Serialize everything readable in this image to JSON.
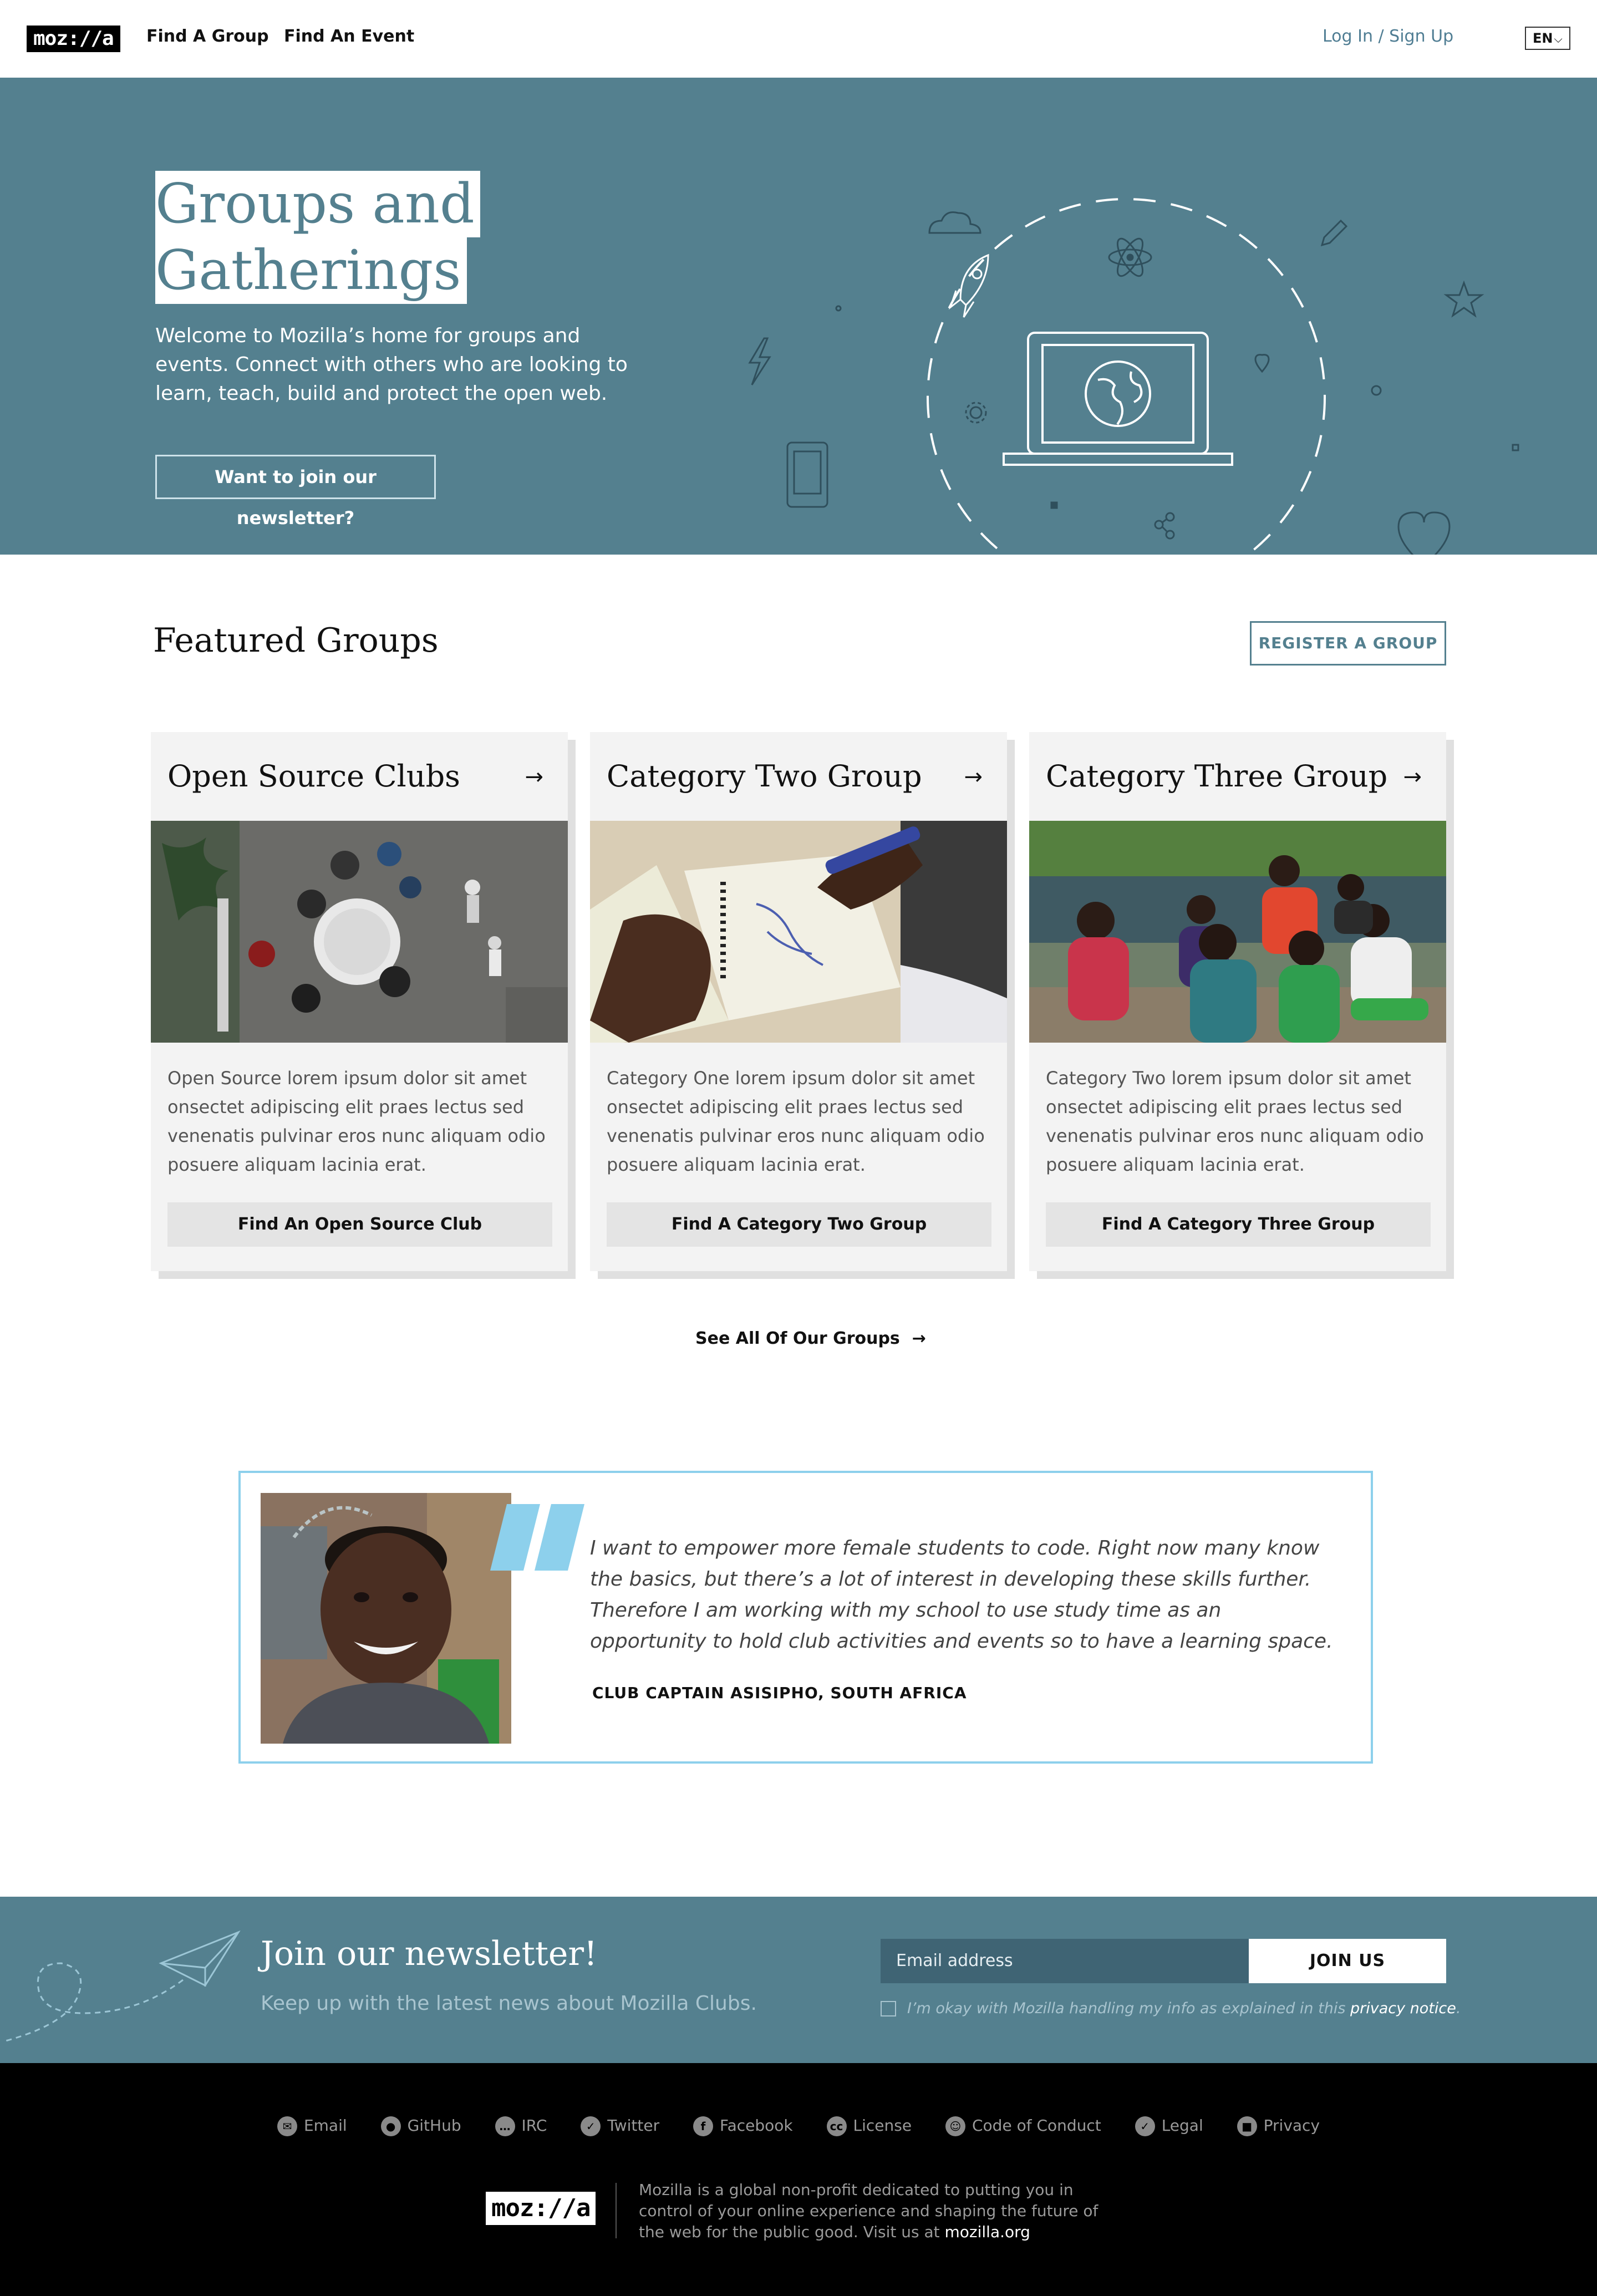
{
  "nav": {
    "logo": "moz://a",
    "links": [
      "Find A Group",
      "Find An Event"
    ],
    "login": "Log In / Sign Up",
    "language": "EN"
  },
  "hero": {
    "title_line1": "Groups and",
    "title_line2": "Gatherings",
    "text": "Welcome to Mozilla’s home for groups and events. Connect with others who are looking to learn, teach, build and protect the open web.",
    "button": "Want to join our newsletter?"
  },
  "featured": {
    "title": "Featured Groups",
    "register_button": "REGISTER A GROUP",
    "cards": [
      {
        "title": "Open Source Clubs",
        "text": "Open Source lorem ipsum dolor sit amet onsectet adipiscing elit praes lectus sed venenatis pulvinar eros nunc aliquam odio posuere aliquam lacinia erat.",
        "button": "Find An Open Source Club"
      },
      {
        "title": "Category Two Group",
        "text": "Category One lorem ipsum dolor sit amet onsectet adipiscing elit praes lectus sed venenatis pulvinar eros nunc aliquam odio posuere aliquam lacinia erat.",
        "button": "Find A Category Two Group"
      },
      {
        "title": "Category Three Group",
        "text": "Category Two lorem ipsum dolor sit amet onsectet adipiscing elit praes lectus sed venenatis pulvinar eros nunc aliquam odio posuere aliquam lacinia erat.",
        "button": "Find A Category Three Group"
      }
    ],
    "see_all": "See All Of Our Groups"
  },
  "testimonial": {
    "quote": "I want to empower more female students to code. Right now many know the basics, but there’s a lot of interest in developing these skills further. Therefore I am working with my school to use study time as an opportunity to hold club activities and events so to have a learning space.",
    "author": "CLUB CAPTAIN ASISIPHO, SOUTH AFRICA"
  },
  "newsletter": {
    "title": "Join our newsletter!",
    "subtitle": "Keep up with the latest news about Mozilla Clubs.",
    "email_placeholder": "Email address",
    "button": "JOIN US",
    "consent": "I’m okay with Mozilla handling my info as explained in this ",
    "consent_link": "privacy notice",
    "consent_end": "."
  },
  "footer": {
    "links": [
      {
        "label": "Email",
        "icon": "email-icon"
      },
      {
        "label": "GitHub",
        "icon": "github-icon"
      },
      {
        "label": "IRC",
        "icon": "irc-icon"
      },
      {
        "label": "Twitter",
        "icon": "twitter-icon"
      },
      {
        "label": "Facebook",
        "icon": "facebook-icon"
      },
      {
        "label": "License",
        "icon": "license-icon"
      },
      {
        "label": "Code of Conduct",
        "icon": "code-of-conduct-icon"
      },
      {
        "label": "Legal",
        "icon": "legal-icon"
      },
      {
        "label": "Privacy",
        "icon": "privacy-icon"
      }
    ],
    "logo": "moz://a",
    "about": "Mozilla is a global non-profit dedicated to putting you in control of your online experience and shaping the future of the web for the public good. Visit us at ",
    "about_link": "mozilla.org"
  },
  "colors": {
    "brand_blue": "#54808f",
    "quote_accent": "#8dd0ec",
    "card_bg": "#f3f3f3"
  }
}
